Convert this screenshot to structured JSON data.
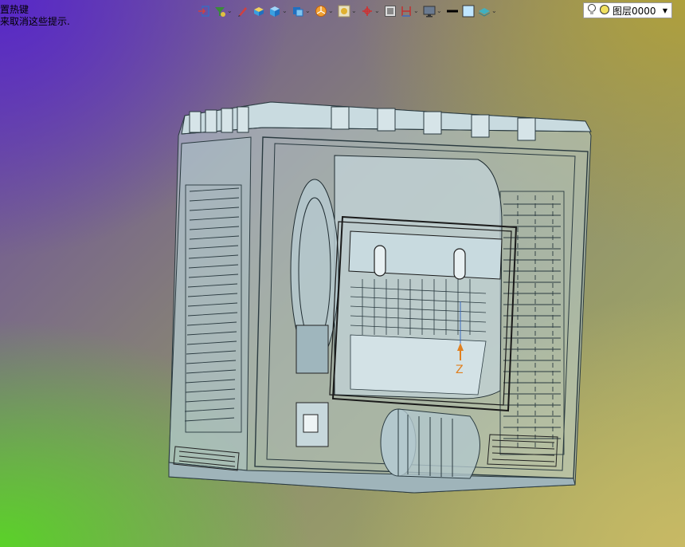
{
  "hint": {
    "line1": "置热键",
    "line2": "来取消这些提示."
  },
  "toolbar": {
    "icons": [
      {
        "name": "exit-icon",
        "color": "#d04040"
      },
      {
        "name": "filter-icon",
        "color": "#3a8a3a"
      },
      {
        "name": "pencil-icon",
        "color": "#d04040"
      },
      {
        "name": "solid-box-icon",
        "color": "#e0b030"
      },
      {
        "name": "cube-view-icon",
        "color": "#3aa0e0"
      },
      {
        "name": "view-orient-icon",
        "color": "#2070c0"
      },
      {
        "name": "render-icon",
        "color": "#e08020"
      },
      {
        "name": "display-style-icon",
        "color": "#c0a040"
      },
      {
        "name": "axis-icon",
        "color": "#d03030"
      },
      {
        "name": "section-icon",
        "color": "#606060"
      },
      {
        "name": "dimension-icon",
        "color": "#c03030"
      },
      {
        "name": "monitor-icon",
        "color": "#404060"
      },
      {
        "name": "line-color-icon",
        "color": "#000000"
      },
      {
        "name": "face-color-icon",
        "color": "#bfe6ff"
      },
      {
        "name": "layer-stack-icon",
        "color": "#40b0c0"
      }
    ]
  },
  "layer": {
    "name": "图层0000",
    "bulb_color": "#f0e060"
  },
  "triad": {
    "z_label": "Z"
  }
}
